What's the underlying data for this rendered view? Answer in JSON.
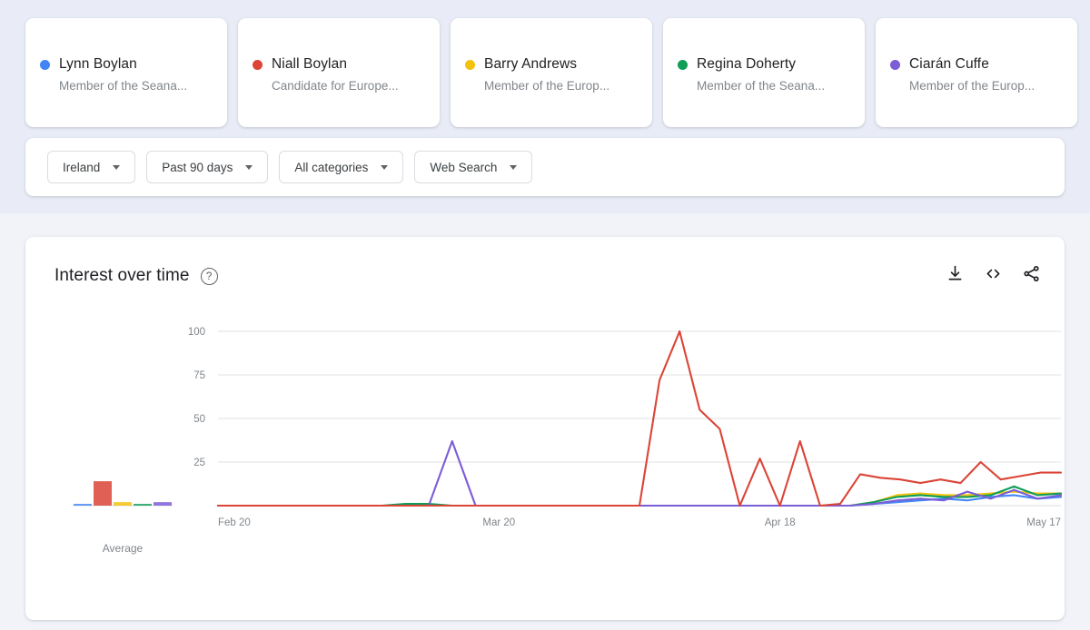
{
  "page": {
    "background_top": "#e9ecf6",
    "background_bottom": "#f1f3f9"
  },
  "entities": [
    {
      "name": "Lynn Boylan",
      "description": "Member of the Seana...",
      "color": "#4285f4"
    },
    {
      "name": "Niall Boylan",
      "description": "Candidate for Europe...",
      "color": "#db4437"
    },
    {
      "name": "Barry Andrews",
      "description": "Member of the Europ...",
      "color": "#f4c20d"
    },
    {
      "name": "Regina Doherty",
      "description": "Member of the Seana...",
      "color": "#0f9d58"
    },
    {
      "name": "Ciarán Cuffe",
      "description": "Member of the Europ...",
      "color": "#7b5dd6"
    }
  ],
  "filters": [
    {
      "label": "Ireland"
    },
    {
      "label": "Past 90 days"
    },
    {
      "label": "All categories"
    },
    {
      "label": "Web Search"
    }
  ],
  "chart_panel": {
    "title": "Interest over time",
    "help_glyph": "?",
    "actions": [
      {
        "name": "download-icon"
      },
      {
        "name": "embed-icon"
      },
      {
        "name": "share-icon"
      }
    ],
    "average_label": "Average"
  },
  "chart_data": {
    "type": "line",
    "title": "Interest over time",
    "xlabel": "",
    "ylabel": "",
    "ylim": [
      0,
      100
    ],
    "yticks": [
      25,
      50,
      75,
      100
    ],
    "grid": true,
    "legend": "cards-above",
    "xticks": [
      "Feb 20",
      "Mar 20",
      "Apr 18",
      "May 17"
    ],
    "xtick_positions": [
      0,
      0.3333,
      0.6667,
      1.0
    ],
    "x": [
      "Feb 20",
      "Feb 23",
      "Feb 26",
      "Mar 1",
      "Mar 4",
      "Mar 7",
      "Mar 10",
      "Mar 13",
      "Mar 16",
      "Mar 19",
      "Mar 20",
      "Mar 22",
      "Mar 25",
      "Mar 28",
      "Mar 31",
      "Apr 3",
      "Apr 6",
      "Apr 9",
      "Apr 12",
      "Apr 15",
      "Apr 18",
      "Apr 21",
      "Apr 23",
      "Apr 25",
      "Apr 27",
      "Apr 29",
      "May 1",
      "May 3",
      "May 5",
      "May 7",
      "May 9",
      "May 11",
      "May 13",
      "May 15",
      "May 17",
      "May 19"
    ],
    "series": [
      {
        "name": "Lynn Boylan",
        "color": "#4285f4",
        "values": [
          0,
          0,
          0,
          0,
          0,
          0,
          0,
          0,
          0,
          0,
          0,
          0,
          0,
          0,
          0,
          0,
          0,
          0,
          0,
          0,
          0,
          0,
          0,
          0,
          0,
          0,
          0,
          0,
          1,
          2,
          3,
          4,
          3,
          5,
          6,
          4,
          5
        ]
      },
      {
        "name": "Niall Boylan",
        "color": "#db4437",
        "values": [
          0,
          0,
          0,
          0,
          0,
          0,
          0,
          0,
          0,
          0,
          0,
          0,
          0,
          0,
          0,
          0,
          0,
          0,
          0,
          0,
          0,
          0,
          72,
          100,
          55,
          44,
          0,
          27,
          0,
          37,
          0,
          1,
          18,
          16,
          15,
          13,
          15,
          13,
          25,
          15,
          17,
          19,
          19
        ]
      },
      {
        "name": "Barry Andrews",
        "color": "#f4c20d",
        "values": [
          0,
          0,
          0,
          0,
          0,
          0,
          0,
          0,
          0,
          0,
          0,
          0,
          0,
          0,
          0,
          0,
          0,
          0,
          0,
          0,
          0,
          0,
          0,
          0,
          0,
          0,
          0,
          0,
          2,
          6,
          7,
          6,
          6,
          7,
          8,
          7,
          7
        ]
      },
      {
        "name": "Regina Doherty",
        "color": "#0f9d58",
        "values": [
          0,
          0,
          0,
          0,
          0,
          0,
          0,
          0,
          1,
          1,
          0,
          0,
          0,
          0,
          0,
          0,
          0,
          0,
          0,
          0,
          0,
          0,
          0,
          0,
          0,
          0,
          0,
          0,
          2,
          5,
          6,
          5,
          5,
          6,
          11,
          6,
          7
        ]
      },
      {
        "name": "Ciarán Cuffe",
        "color": "#7b5dd6",
        "values": [
          0,
          0,
          0,
          0,
          0,
          0,
          0,
          0,
          0,
          0,
          37,
          0,
          0,
          0,
          0,
          0,
          0,
          0,
          0,
          0,
          0,
          0,
          0,
          0,
          0,
          0,
          0,
          0,
          1,
          3,
          4,
          3,
          8,
          4,
          9,
          4,
          6
        ]
      }
    ],
    "average_bars": [
      {
        "name": "Lynn Boylan",
        "color": "#4285f4",
        "value": 1
      },
      {
        "name": "Niall Boylan",
        "color": "#db4437",
        "value": 14
      },
      {
        "name": "Barry Andrews",
        "color": "#f4c20d",
        "value": 2
      },
      {
        "name": "Regina Doherty",
        "color": "#0f9d58",
        "value": 1
      },
      {
        "name": "Ciarán Cuffe",
        "color": "#7b5dd6",
        "value": 2
      }
    ]
  }
}
